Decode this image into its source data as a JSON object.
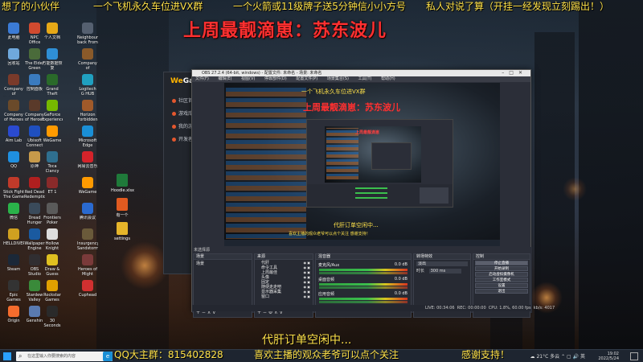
{
  "overlay": {
    "ticker_left": "想了的小伙伴",
    "ticker_mid": "一个飞机永久车位进VX群",
    "ticker_right_1": "一个火箭或11级牌子送5分钟信小小方号",
    "ticker_right_2": "私人对说了算（开挂一经发现立刻踢出！）",
    "headline": "上周最靓滴崽：苏东波儿",
    "order_status": "代肝订单空闲中...",
    "qq_group": "QQ大主群：815402828",
    "follow_tip": "喜欢主播的观众老爷可以点个关注",
    "thanks": "感谢支持！"
  },
  "desktop_icons": [
    {
      "label": "此电脑",
      "icon": "computer-icon",
      "color": "#3b7bd6"
    },
    {
      "label": "NPC Office",
      "icon": "office-icon",
      "color": "#d04a2f"
    },
    {
      "label": "个人文档",
      "icon": "folder-icon",
      "color": "#e6a817"
    },
    {
      "label": "Neighbours back From",
      "icon": "game-icon",
      "color": "#556070"
    },
    {
      "label": "回收站",
      "icon": "recycle-bin-icon",
      "color": "#6fa8dc"
    },
    {
      "label": "The Elder Green",
      "icon": "game-icon",
      "color": "#4a6b3a"
    },
    {
      "label": "万能数据恢复",
      "icon": "recovery-icon",
      "color": "#2f8fd6"
    },
    {
      "label": "Company of Neighbours Heroes",
      "icon": "game-icon",
      "color": "#8a5a2a"
    },
    {
      "label": "Company of Neighbours From Hell",
      "icon": "game-icon",
      "color": "#7a3a2a"
    },
    {
      "label": "控制面板",
      "icon": "control-panel-icon",
      "color": "#3a7bbf"
    },
    {
      "label": "Grand Theft Auto V",
      "icon": "gta-icon",
      "color": "#2a6a2a"
    },
    {
      "label": "Logitech G HUB",
      "icon": "logitech-icon",
      "color": "#20a0c0"
    },
    {
      "label": "Company of Heroes Tal",
      "icon": "game-icon",
      "color": "#6a4a2a"
    },
    {
      "label": "Company of Heroes From Hell 2",
      "icon": "game-icon",
      "color": "#5a3a2a"
    },
    {
      "label": "GeForce Experience",
      "icon": "nvidia-icon",
      "color": "#76b900"
    },
    {
      "label": "Horizon Forbidden",
      "icon": "game-icon",
      "color": "#a05a2a"
    },
    {
      "label": "Aim Lab",
      "icon": "aimlab-icon",
      "color": "#2a4ad0"
    },
    {
      "label": "Ubisoft Connect",
      "icon": "ubisoft-icon",
      "color": "#1f4fbf"
    },
    {
      "label": "WeGame",
      "icon": "wegame-icon",
      "color": "#ff9a00"
    },
    {
      "label": "Microsoft Edge",
      "icon": "edge-icon",
      "color": "#1a8fd6"
    },
    {
      "label": "QQ",
      "icon": "qq-icon",
      "color": "#1f8fe0"
    },
    {
      "label": "原神",
      "icon": "genshin-icon",
      "color": "#c79a4a"
    },
    {
      "label": "Toca Clancy",
      "icon": "game-icon",
      "color": "#2f6f8f"
    },
    {
      "label": "网易云音乐",
      "icon": "music-icon",
      "color": "#d4232a"
    },
    {
      "label": "Stick Fight The Game",
      "icon": "game-icon",
      "color": "#c03a2a"
    },
    {
      "label": "Red Dead Redemption",
      "icon": "rdr-icon",
      "color": "#b01f1f"
    },
    {
      "label": "ET 1",
      "icon": "game-icon",
      "color": "#8a2a2a"
    },
    {
      "label": "WeGame",
      "icon": "wegame-icon",
      "color": "#ff9a00"
    },
    {
      "label": "微信",
      "icon": "wechat-icon",
      "color": "#2ab24a"
    },
    {
      "label": "Dread Hunger",
      "icon": "game-icon",
      "color": "#3a4a5a"
    },
    {
      "label": "Frontiers Poker",
      "icon": "game-icon",
      "color": "#5a5a5a"
    },
    {
      "label": "腾讯会议",
      "icon": "meeting-icon",
      "color": "#2a6ad0"
    },
    {
      "label": "HELLDIVERS",
      "icon": "game-icon",
      "color": "#d0a020"
    },
    {
      "label": "Wallpaper Engine",
      "icon": "wallpaper-icon",
      "color": "#1a5aa0"
    },
    {
      "label": "Hollow Knight",
      "icon": "game-icon",
      "color": "#ddd"
    },
    {
      "label": "Insurgency Sandstorm",
      "icon": "game-icon",
      "color": "#6a5a3a"
    },
    {
      "label": "Steam",
      "icon": "steam-icon",
      "color": "#1b2838"
    },
    {
      "label": "OBS Studio",
      "icon": "obs-icon",
      "color": "#302e31"
    },
    {
      "label": "Draw & Guess",
      "icon": "game-icon",
      "color": "#e0c020"
    },
    {
      "label": "Heroes of Might",
      "icon": "game-icon",
      "color": "#7a3a3a"
    },
    {
      "label": "Epic Games Launcher",
      "icon": "epic-icon",
      "color": "#333"
    },
    {
      "label": "Stardew Valley",
      "icon": "game-icon",
      "color": "#3a8a3a"
    },
    {
      "label": "Rockstar Games",
      "icon": "rockstar-icon",
      "color": "#e0a000"
    },
    {
      "label": "Cuphead",
      "icon": "game-icon",
      "color": "#d03030"
    },
    {
      "label": "Origin",
      "icon": "origin-icon",
      "color": "#f56c2d"
    },
    {
      "label": "Genshin",
      "icon": "genshin-icon",
      "color": "#5a7ab0"
    },
    {
      "label": "30 Seconds",
      "icon": "game-icon",
      "color": "#2a2a2a"
    }
  ],
  "mid_icons": [
    {
      "label": "Hoodle.xlsx",
      "icon": "excel-icon",
      "color": "#1f7a3a"
    },
    {
      "label": "有一个",
      "icon": "app-icon",
      "color": "#e05a20"
    },
    {
      "label": "settings",
      "icon": "folder-icon",
      "color": "#e6b52a"
    }
  ],
  "wegame": {
    "logo_a": "We",
    "logo_b": "Game",
    "nav": [
      "社区首页",
      "游戏库",
      "我的游戏",
      "开发者"
    ]
  },
  "obs": {
    "title": "OBS 27.2.4 (64-bit, windows) - 配置文件: 未命名 - 场景: 未命名",
    "menu": [
      "文件(F)",
      "编辑(E)",
      "视图(V)",
      "停靠部件(D)",
      "配置文件(P)",
      "场景集合(S)",
      "工具(T)",
      "帮助(H)"
    ],
    "no_source_selected": "未选择源",
    "docks": {
      "scenes_title": "场景",
      "scenes": [
        "场景"
      ],
      "sources_title": "来源",
      "sources": [
        "代肝",
        "命令工具",
        "上周最佳",
        "头像",
        "固定",
        "随便走走吧",
        "显示器采集",
        "窗口"
      ],
      "mixer_title": "混音器",
      "mixer": [
        {
          "name": "麦克风/Aux",
          "db": "0.0 dB"
        },
        {
          "name": "桌面音频",
          "db": "0.0 dB"
        },
        {
          "name": "应用音频",
          "db": "0.0 dB"
        }
      ],
      "transitions_title": "转场特效",
      "transition_type": "淡出",
      "duration_label": "时长",
      "duration_value": "300 ms",
      "controls_title": "控制",
      "controls": [
        "停止直播",
        "开始录制",
        "启动虚拟摄像机",
        "工作室模式",
        "设置",
        "退出"
      ]
    },
    "status": {
      "live": "LIVE: 00:34:06",
      "rec": "REC: 00:00:00",
      "cpu": "CPU: 1.8%, 60.00 fps",
      "kbps": "kb/s: 4017"
    }
  },
  "preview_overlay": {
    "inner_headline": "上周最靓滴崽：苏东波儿",
    "inner_status": "代肝订单空闲中...",
    "inner_bottom": "喜欢主播的观众老爷可以点个关注  感谢支持！"
  },
  "taskbar": {
    "search_placeholder": "在这里输入你要搜索的内容",
    "weather": "21°C 多云",
    "time": "19:02",
    "date": "2022/5/24",
    "lang": "英"
  }
}
